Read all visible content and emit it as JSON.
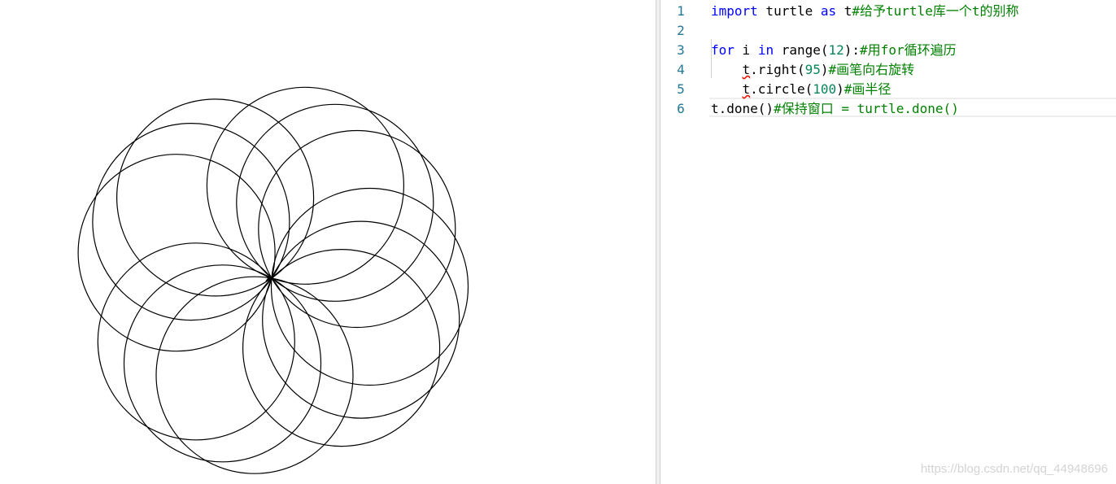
{
  "turtle_canvas": {
    "shape": "12 overlapping circles drawn by turtle.circle",
    "stroke_color": "#000000"
  },
  "editor": {
    "lines": [
      {
        "number": "1",
        "tokens": [
          {
            "text": "import",
            "type": "kw"
          },
          {
            "text": " turtle ",
            "type": "plain"
          },
          {
            "text": "as",
            "type": "kw"
          },
          {
            "text": " t",
            "type": "plain"
          },
          {
            "text": "#给予turtle库一个t的别称",
            "type": "cmt"
          }
        ]
      },
      {
        "number": "2",
        "tokens": []
      },
      {
        "number": "3",
        "tokens": [
          {
            "text": "for",
            "type": "kw"
          },
          {
            "text": " i ",
            "type": "plain"
          },
          {
            "text": "in",
            "type": "kw"
          },
          {
            "text": " range(",
            "type": "plain"
          },
          {
            "text": "12",
            "type": "num"
          },
          {
            "text": "):",
            "type": "plain"
          },
          {
            "text": "#用for循环遍历",
            "type": "cmt"
          }
        ]
      },
      {
        "number": "4",
        "tokens": [
          {
            "text": "    ",
            "type": "plain"
          },
          {
            "text": "t",
            "type": "squig"
          },
          {
            "text": ".right(",
            "type": "plain"
          },
          {
            "text": "95",
            "type": "num"
          },
          {
            "text": ")",
            "type": "plain"
          },
          {
            "text": "#画笔向右旋转",
            "type": "cmt"
          }
        ]
      },
      {
        "number": "5",
        "tokens": [
          {
            "text": "    ",
            "type": "plain"
          },
          {
            "text": "t",
            "type": "squig"
          },
          {
            "text": ".circle(",
            "type": "plain"
          },
          {
            "text": "100",
            "type": "num"
          },
          {
            "text": ")",
            "type": "plain"
          },
          {
            "text": "#画半径",
            "type": "cmt"
          }
        ]
      },
      {
        "number": "6",
        "tokens": [
          {
            "text": "t.done()",
            "type": "plain"
          },
          {
            "text": "#保持窗口 = turtle.done()",
            "type": "cmt"
          }
        ]
      }
    ],
    "colors": {
      "keyword": "#0000ff",
      "number": "#098658",
      "comment": "#008000",
      "line_number": "#237893",
      "squiggle": "#e51400"
    }
  },
  "watermark": "https://blog.csdn.net/qq_44948696"
}
